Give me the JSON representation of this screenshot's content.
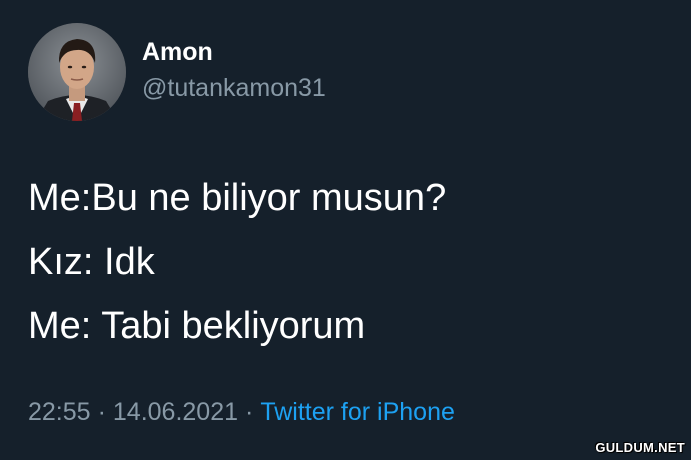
{
  "tweet": {
    "author": {
      "display_name": "Amon",
      "handle": "@tutankamon31",
      "avatar_icon": "profile-photo"
    },
    "text_lines": [
      "Me:Bu ne biliyor musun?",
      "Kız: Idk",
      "Me: Tabi bekliyorum"
    ],
    "time": "22:55",
    "separator": "·",
    "date": "14.06.2021",
    "source": "Twitter for iPhone"
  },
  "watermark": "GULDUM.NET",
  "colors": {
    "background": "#15202b",
    "text_primary": "#ffffff",
    "text_secondary": "#8899a6",
    "link": "#1da1f2"
  }
}
